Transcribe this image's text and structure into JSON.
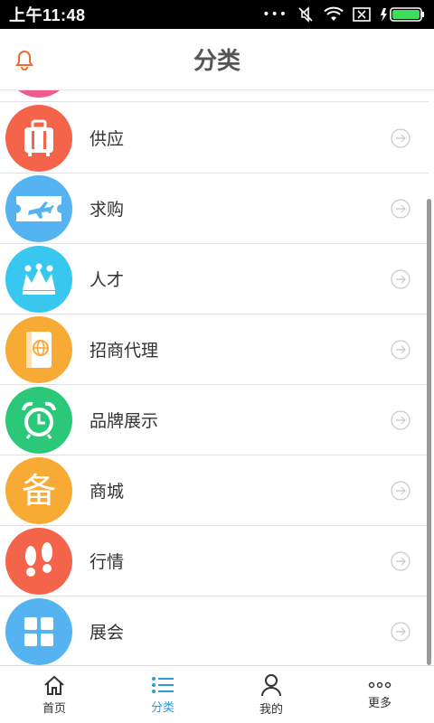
{
  "status_bar": {
    "time": "上午11:48",
    "dots": "•••"
  },
  "header": {
    "title": "分类"
  },
  "list": {
    "items": [
      {
        "label": "供应",
        "color": "#f4644a",
        "icon": "luggage-icon"
      },
      {
        "label": "求购",
        "color": "#54b3f0",
        "icon": "plane-ticket-icon"
      },
      {
        "label": "人才",
        "color": "#38c8ef",
        "icon": "crown-icon"
      },
      {
        "label": "招商代理",
        "color": "#f8ab34",
        "icon": "passport-icon"
      },
      {
        "label": "品牌展示",
        "color": "#2cc879",
        "icon": "alarm-clock-icon"
      },
      {
        "label": "商城",
        "color": "#f8ab34",
        "icon": "bei-char-icon",
        "glyph": "备"
      },
      {
        "label": "行情",
        "color": "#f4644a",
        "icon": "footprints-icon"
      },
      {
        "label": "展会",
        "color": "#54b3f0",
        "icon": "grid-icon"
      }
    ]
  },
  "tabbar": {
    "tabs": [
      {
        "label": "首页",
        "icon": "home-icon"
      },
      {
        "label": "分类",
        "icon": "list-icon",
        "active": true
      },
      {
        "label": "我的",
        "icon": "user-icon"
      },
      {
        "label": "更多",
        "icon": "more-icon"
      }
    ]
  }
}
